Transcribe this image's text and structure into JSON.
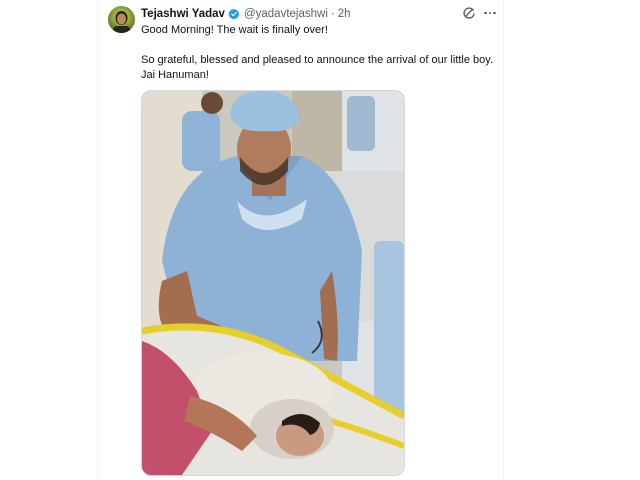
{
  "tweet": {
    "author_name": "Tejashwi Yadav",
    "author_handle": "@yadavtejashwi",
    "separator": "·",
    "timestamp": "2h",
    "verified": true,
    "text_line1": "Good Morning! The wait is finally over!",
    "text_paragraph2": "So grateful, blessed and pleased to announce the arrival of our little boy. Jai Hanuman!",
    "icons": {
      "avatar": "profile-avatar",
      "verified": "verified-badge-icon",
      "grok": "grok-icon",
      "more": "more-options-icon"
    },
    "media": {
      "type": "photo"
    }
  },
  "colors": {
    "text": "#0f1419",
    "secondary": "#536471",
    "verified_blue": "#1d9bf0",
    "border": "#eff3f4"
  }
}
